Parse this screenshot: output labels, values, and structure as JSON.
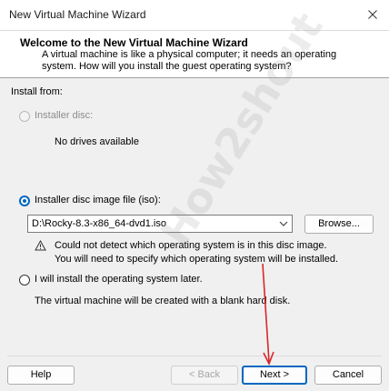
{
  "window": {
    "title": "New Virtual Machine Wizard"
  },
  "header": {
    "title": "Welcome to the New Virtual Machine Wizard",
    "description": "A virtual machine is like a physical computer; it needs an operating system. How will you install the guest operating system?"
  },
  "install_from": {
    "label": "Install from:",
    "installer_disc": {
      "label": "Installer disc:",
      "status": "No drives available"
    },
    "iso": {
      "label": "Installer disc image file (iso):",
      "value": "D:\\Rocky-8.3-x86_64-dvd1.iso",
      "browse_label": "Browse...",
      "warning_line1": "Could not detect which operating system is in this disc image.",
      "warning_line2": "You will need to specify which operating system will be installed."
    },
    "later": {
      "label": "I will install the operating system later.",
      "description": "The virtual machine will be created with a blank hard disk."
    }
  },
  "buttons": {
    "help": "Help",
    "back": "< Back",
    "next": "Next >",
    "cancel": "Cancel"
  },
  "watermark": {
    "text": "How2shout"
  },
  "colors": {
    "accent": "#0067c0",
    "annotation_arrow": "#d9262b"
  }
}
